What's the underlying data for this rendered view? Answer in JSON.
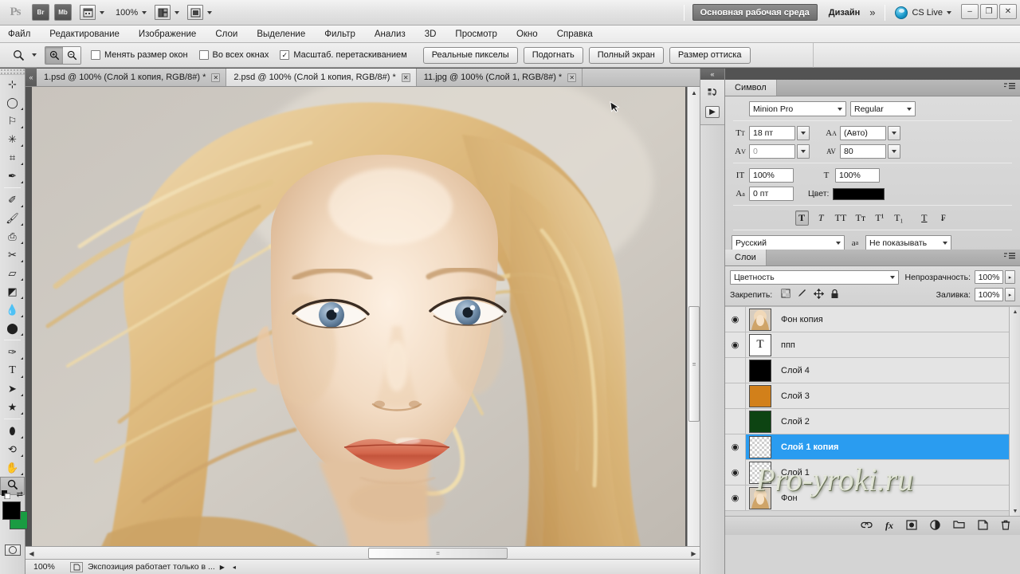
{
  "app": {
    "logo": "Ps",
    "bridge_button": "Br",
    "minibridge_button": "Mb",
    "view_extras_icon": "view-extras-icon",
    "zoom_level": "100%",
    "arrange_icon": "arrange-documents-icon",
    "screenmode_icon": "screen-mode-icon",
    "workspace_active": "Основная рабочая среда",
    "workspace_other": "Дизайн",
    "workspace_more": "»",
    "cs_live": "CS Live",
    "win_minimize": "–",
    "win_restore": "❐",
    "win_close": "✕"
  },
  "menubar": {
    "items": [
      "Файл",
      "Редактирование",
      "Изображение",
      "Слои",
      "Выделение",
      "Фильтр",
      "Анализ",
      "3D",
      "Просмотр",
      "Окно",
      "Справка"
    ]
  },
  "options_bar": {
    "tool_icon": "zoom-tool-icon",
    "zoom_in_icon": "zoom-in-icon",
    "zoom_out_icon": "zoom-out-icon",
    "checkboxes": [
      {
        "label": "Менять размер окон",
        "checked": false
      },
      {
        "label": "Во всех окнах",
        "checked": false
      },
      {
        "label": "Масштаб. перетаскиванием",
        "checked": true
      }
    ],
    "check_glyph": "✓",
    "buttons": [
      "Реальные пикселы",
      "Подогнать",
      "Полный экран",
      "Размер оттиска"
    ]
  },
  "toolbox": {
    "collapse_icon": "collapse-panel-icon",
    "tools": [
      {
        "name": "move-tool",
        "glyph": "✤",
        "has_flyout": false
      },
      {
        "name": "elliptical-marquee-tool",
        "glyph": "○",
        "has_flyout": true
      },
      {
        "name": "lasso-tool",
        "glyph": "✇",
        "has_flyout": true
      },
      {
        "name": "quick-selection-tool",
        "glyph": "✳",
        "has_flyout": true
      },
      {
        "name": "crop-tool",
        "glyph": "⛏",
        "has_flyout": true
      },
      {
        "name": "eyedropper-tool",
        "glyph": "✐",
        "has_flyout": true
      },
      {
        "name": "spot-healing-brush-tool",
        "glyph": "✐",
        "has_flyout": true
      },
      {
        "name": "brush-tool",
        "glyph": "✎",
        "has_flyout": true
      },
      {
        "name": "clone-stamp-tool",
        "glyph": "⚑",
        "has_flyout": true
      },
      {
        "name": "history-brush-tool",
        "glyph": "✒",
        "has_flyout": true
      },
      {
        "name": "eraser-tool",
        "glyph": "▰",
        "has_flyout": true
      },
      {
        "name": "gradient-tool",
        "glyph": "◧",
        "has_flyout": true
      },
      {
        "name": "blur-tool",
        "glyph": "●",
        "has_flyout": true
      },
      {
        "name": "dodge-tool",
        "glyph": "⚲",
        "has_flyout": true
      },
      {
        "name": "pen-tool",
        "glyph": "✒",
        "has_flyout": true
      },
      {
        "name": "horizontal-type-tool",
        "glyph": "T",
        "has_flyout": true
      },
      {
        "name": "path-selection-tool",
        "glyph": "➤",
        "has_flyout": true
      },
      {
        "name": "custom-shape-tool",
        "glyph": "★",
        "has_flyout": true
      },
      {
        "name": "3d-object-rotate-tool",
        "glyph": "⛁",
        "has_flyout": true
      },
      {
        "name": "3d-camera-rotate-tool",
        "glyph": "↺",
        "has_flyout": true
      },
      {
        "name": "hand-tool",
        "glyph": "✋",
        "has_flyout": true
      },
      {
        "name": "zoom-tool",
        "glyph": "⌕",
        "has_flyout": false,
        "selected": true
      }
    ],
    "default_swatch_icon": "default-colors-icon",
    "swap_swatch_icon": "swap-colors-icon",
    "foreground_color": "#000000",
    "background_color": "#1a9c42",
    "quickmask_icon": "quick-mask-icon"
  },
  "document_tabs": {
    "collapse_icon": "«",
    "close_glyph": "✕",
    "tabs": [
      {
        "title": "1.psd @ 100% (Слой 1 копия, RGB/8#) *",
        "active": false
      },
      {
        "title": "2.psd @ 100% (Слой 1 копия, RGB/8#) *",
        "active": true
      },
      {
        "title": "11.jpg @ 100% (Слой 1, RGB/8#) *",
        "active": false
      }
    ]
  },
  "canvas": {
    "cursor_icon": "arrow-cursor",
    "scroll_up_glyph": "▲",
    "scroll_down_glyph": "▼",
    "scroll_left_glyph": "◀",
    "scroll_right_glyph": "▶",
    "grip_glyph": "≡"
  },
  "status_bar": {
    "zoom": "100%",
    "doc_icon": "document-icon",
    "message": "Экспозиция работает только в ...",
    "play_glyph": "▶",
    "left_glyph": "◂"
  },
  "icon_dock": {
    "collapse_glyph": "«",
    "icons": [
      {
        "name": "history-panel-icon",
        "glyph": "↷"
      },
      {
        "name": "actions-panel-icon",
        "glyph": "▶"
      }
    ]
  },
  "character_panel": {
    "tab_label": "Символ",
    "menu_icon": "panel-menu-icon",
    "font_family": "Minion Pro",
    "font_style": "Regular",
    "size_icon": "font-size-icon",
    "font_size": "18 пт",
    "leading_icon": "leading-icon",
    "leading": "(Авто)",
    "kerning_icon": "kerning-icon",
    "kerning": "0",
    "tracking_icon": "tracking-icon",
    "tracking": "80",
    "vscale_icon": "vertical-scale-icon",
    "vertical_scale": "100%",
    "hscale_icon": "horizontal-scale-icon",
    "horizontal_scale": "100%",
    "baseline_icon": "baseline-shift-icon",
    "baseline_shift": "0 пт",
    "color_label": "Цвет:",
    "color_value": "#000000",
    "style_buttons": [
      {
        "name": "faux-bold-button",
        "glyph": "T",
        "selected": true
      },
      {
        "name": "faux-italic-button",
        "glyph": "T",
        "selected": false
      },
      {
        "name": "all-caps-button",
        "glyph": "TT",
        "selected": false
      },
      {
        "name": "small-caps-button",
        "glyph": "Tт",
        "selected": false
      },
      {
        "name": "superscript-button",
        "glyph": "T¹",
        "selected": false
      },
      {
        "name": "subscript-button",
        "glyph": "T₁",
        "selected": false
      },
      {
        "name": "underline-button",
        "glyph": "T",
        "selected": false
      },
      {
        "name": "strikethrough-button",
        "glyph": "₣",
        "selected": false
      }
    ],
    "language": "Русский",
    "antialias_icon": "anti-aliasing-icon",
    "antialias": "Не показывать"
  },
  "layers_panel": {
    "tab_label": "Слои",
    "menu_icon": "panel-menu-icon",
    "blend_mode": "Цветность",
    "opacity_label": "Непрозрачность:",
    "opacity_value": "100%",
    "lock_label": "Закрепить:",
    "lock_icons": [
      {
        "name": "lock-transparency-icon",
        "glyph": "▨"
      },
      {
        "name": "lock-image-pixels-icon",
        "glyph": "✐"
      },
      {
        "name": "lock-position-icon",
        "glyph": "✤"
      },
      {
        "name": "lock-all-icon",
        "glyph": "⚿"
      }
    ],
    "fill_label": "Заливка:",
    "fill_value": "100%",
    "eye_glyph": "◉",
    "layers": [
      {
        "name": "Фон копия",
        "visible": true,
        "selected": false,
        "thumb": "photo",
        "thumb_color": "#d9b98e"
      },
      {
        "name": "ппп",
        "visible": true,
        "selected": false,
        "thumb": "text",
        "thumb_color": "#ffffff"
      },
      {
        "name": "Слой 4",
        "visible": false,
        "selected": false,
        "thumb": "solid",
        "thumb_color": "#000000"
      },
      {
        "name": "Слой 3",
        "visible": false,
        "selected": false,
        "thumb": "solid",
        "thumb_color": "#d2801a"
      },
      {
        "name": "Слой 2",
        "visible": false,
        "selected": false,
        "thumb": "solid",
        "thumb_color": "#0d4412"
      },
      {
        "name": "Слой 1 копия",
        "visible": true,
        "selected": true,
        "thumb": "checker",
        "thumb_color": "#ffffff"
      },
      {
        "name": "Слой 1",
        "visible": true,
        "selected": false,
        "thumb": "checker",
        "thumb_color": "#ffffff"
      },
      {
        "name": "Фон",
        "visible": true,
        "selected": false,
        "thumb": "photo",
        "thumb_color": "#d9b98e"
      }
    ],
    "footer_icons": [
      {
        "name": "link-layers-icon",
        "glyph": "⚭"
      },
      {
        "name": "layer-style-icon",
        "glyph": "fx"
      },
      {
        "name": "layer-mask-icon",
        "glyph": "▣"
      },
      {
        "name": "adjustment-layer-icon",
        "glyph": "◑"
      },
      {
        "name": "new-group-icon",
        "glyph": "▭"
      },
      {
        "name": "new-layer-icon",
        "glyph": "❐"
      },
      {
        "name": "delete-layer-icon",
        "glyph": "⌧"
      }
    ],
    "selection_color": "#2a9cf0"
  },
  "watermark": {
    "text": "Pro-yroki.ru"
  }
}
